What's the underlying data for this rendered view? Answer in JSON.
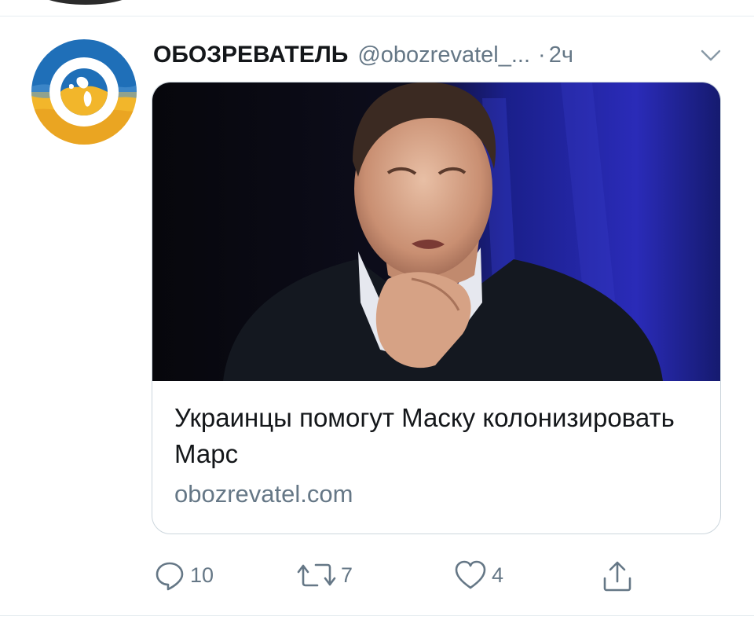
{
  "tweet": {
    "display_name": "ОБОЗРЕВАТЕЛЬ",
    "handle": "@obozrevatel_...",
    "separator": "·",
    "time": "2ч"
  },
  "card": {
    "title": "Украинцы помогут Маску колонизировать Марс",
    "domain": "obozrevatel.com"
  },
  "actions": {
    "replies": "10",
    "retweets": "7",
    "likes": "4"
  },
  "icons": {
    "reply": "reply-icon",
    "retweet": "retweet-icon",
    "like": "heart-icon",
    "share": "share-icon",
    "caret": "chevron-down-icon"
  },
  "colors": {
    "secondary_text": "#657786",
    "card_border": "#ccd6dd",
    "brand_blue": "#1f6fb8",
    "brand_yellow": "#f2b62b"
  }
}
